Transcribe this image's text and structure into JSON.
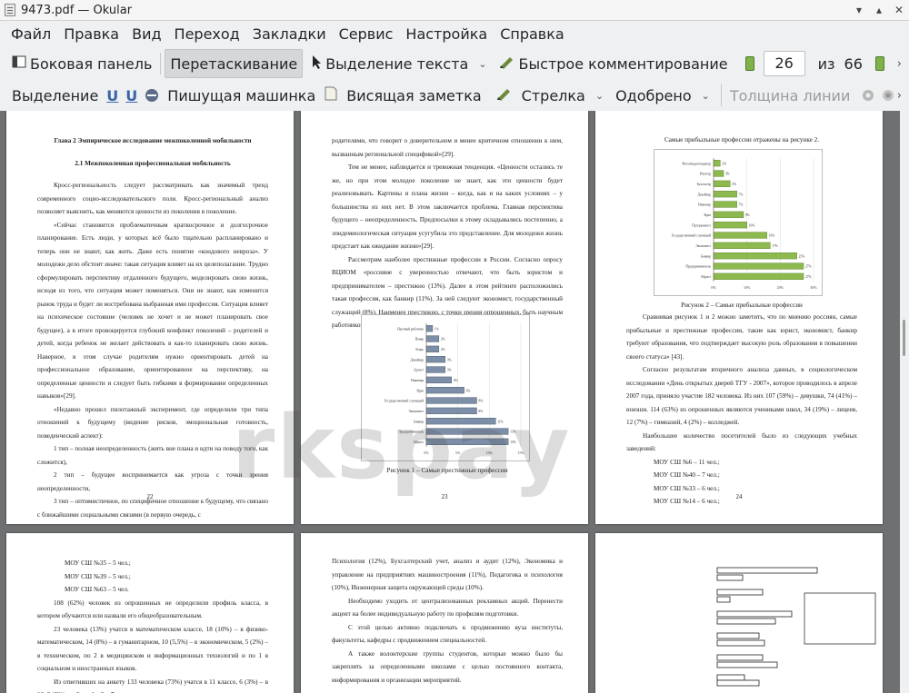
{
  "window": {
    "title": "9473.pdf — Okular"
  },
  "menu": [
    "Файл",
    "Правка",
    "Вид",
    "Переход",
    "Закладки",
    "Сервис",
    "Настройка",
    "Справка"
  ],
  "toolbar1": {
    "sidebar": "Боковая панель",
    "drag": "Перетаскивание",
    "text_select": "Выделение текста",
    "quick_comment": "Быстрое комментирование",
    "page_current": "26",
    "page_of": "из",
    "page_total": "66"
  },
  "toolbar2": {
    "highlight": "Выделение",
    "typewriter": "Пишущая машинка",
    "sticky_note": "Висящая заметка",
    "arrow": "Стрелка",
    "stamp": "Одобрено",
    "line_width": "Толщина линии"
  },
  "watermark": "rkspay",
  "pages": {
    "p22": {
      "heading1": "Глава 2 Эмпирическое исследование межпоколенной мобильности",
      "heading2": "2.1 Межпоколенная профессиональная мобильность",
      "paras": [
        "Кросс-региональность следует рассматривать как значимый тренд современного социо-исследовательского поля. Кросс-региональный анализ позволяет выяснить, как меняются ценности из поколения в поколение.",
        "«Сейчас становится проблематичным краткосрочное и долгосрочное планирование. Есть люди, у которых всё было тщательно распланировано и теперь они не знают, как жить. Даже есть понятие «кондового невроза». У молодежи дело обстоит иначе: такая ситуация влияет на их целеполагание. Трудно сформулировать перспективу отдаленного будущего, моделировать свою жизнь, исходя из того, что ситуация может поменяться. Они не знают, как изменится рынок труда и будет ли востребована выбранная ими профессия. Ситуация влияет на психическое состояние (человек не хочет и не может планировать свое будущее), а в итоге провоцируется глубокий конфликт поколений – родителей и детей, когда ребенок не желает действовать в как-то планировать свою жизнь. Наверное, в этом случае родителям нужно ориентировать детей на профессиональное образование, ориентированное на перспективу, на определенные ценности и следует быть гибкими в формировании определенных навыков»[29].",
        "«Недавно прошел пилотажный эксперимент, где определили три типа отношений к будущему (видение рисков, эмоциональная готовность, поведенческий аспект):",
        "1 тип – полная неопределенность (жить вне плана и идти на поводу того, как сложится),",
        "2 тип – будущее воспринимается как угроза с точки зрения неопределенности,",
        "3 тип – оптимистичное, по специфичное отношение к будущему, что связано с ближайшими социальными связями (в первую очередь, с"
      ],
      "number": "22"
    },
    "p23": {
      "paras": [
        "родителями, что говорит о доверительном и менее критичном отношении к ним, вызванным региональной спецификой»[29].",
        "Тем не менее, наблюдается и тревожная тенденция. «Ценности остались те же, но при этом молодое поколение не знает, как эти ценности будет реализовывать. Картины и плана жизни – когда, как и на каких условиях – у большинства из них нет. В этом заключается проблема. Главная перспектива будущего – неопределенность. Предпосылки к этому складывались постепенно, а эпидемиологическая ситуация усугубила это представление. Для молодежи жизнь предстает как ожидание жизни»[29].",
        "Рассмотрим наиболее престижные профессии в России. Согласно опросу ВЦИОМ «россияне с уверенностью отвечают, что быть юристом и предпринимателем – престижно (13%). Далее в этом рейтинге расположились такая профессия, как банкир (11%). За ней следуют экономист, государственный служащий (8%). Наименее престижно, с точки зрения опрошенных, быть научным работником и учителем» [23, 45]."
      ],
      "caption": "Рисунок 1 – Самые престижные профессии",
      "number": "23"
    },
    "p24": {
      "intro": "Самые прибыльные профессии отражены на рисунке 2.",
      "caption": "Рисунок 2 – Самые прибыльные профессии",
      "paras": [
        "Сравнивая рисунок 1 и 2 можно заметить, что по мнению россиян, самые прибыльные и престижные профессии, такие как юрист, экономист, банкир требуют образования, что подтверждает высокую роль образования в повышении своего статуса» [43].",
        "Согласно результатам вторичного анализа данных, в социологическом исследовании «День открытых дверей ТГУ - 2007», которое проводилось в апреле 2007 года, приняло участие 182 человека. Из них 107 (59%) – девушки, 74 (41%) – юноши. 114 (63%) из опрошенных являются учениками школ, 34 (19%) – лицеев, 12 (7%) – гимназий, 4 (2%) – колледжей.",
        "Наибольшее количество посетителей было из следующих учебных заведений:"
      ],
      "list": [
        "МОУ СШ №6 – 11 чел.;",
        "МОУ СШ №40 – 7 чел.;",
        "МОУ СШ №33 – 6 чел.;",
        "МОУ СШ №14 – 6 чел.;"
      ],
      "number": "24"
    },
    "p25": {
      "list": [
        "МОУ СШ №35 – 5 чел.;",
        "МОУ СШ №39 – 5 чел.;",
        "МОУ СШ №63 – 5 чел."
      ],
      "paras": [
        "108 (62%) человек из опрошенных не определили профиль класса, в котором обучаются или назвали его общеобразовательным.",
        "23 человека (13%) учатся в математическом классе, 18 (10%) – в физико-математическом, 14 (8%) – в гуманитарном, 10 (5,5%) – в экономическом, 5 (2%) – в техническом, по 2 в медицинском и информационных технологий и по 1 в социальном и иностранных языков.",
        "Из ответивших на анкету 133 человека (73%) учатся в 11 классе, 6 (3%) – в 10, 3 (2%) – в 9, по 1 в 8 и 7 классе."
      ]
    },
    "p26": {
      "paras": [
        "Психология (12%), Бухгалтерский учет, анализ и аудит (12%), Экономика и управление на предприятиях машиностроения (11%), Педагогика и психология (10%), Инженерная защита окружающей среды (10%).",
        "Необходимо уходить от централизованных рекламных акций. Перенести акцент на более индивидуальную работу по профилям подготовки.",
        "С этой целью активно подключать к продвижению вуза институты, факультеты, кафедры с продвижением специальностей.",
        "А также волонтерские группы студентов, которые можно было бы закреплять за определенными школами с целью постоянного контакта, информирования и организации мероприятий."
      ]
    }
  },
  "chart_data": [
    {
      "type": "bar",
      "title": "Рисунок 1 – Самые престижные профессии",
      "orientation": "horizontal",
      "categories": [
        "Юрист",
        "Предприниматель",
        "Банкир",
        "Экономист",
        "Государственный служащий",
        "Врач",
        "Инженер",
        "Артист",
        "Дизайнер",
        "Егерь",
        "Повар",
        "Научный работник"
      ],
      "values": [
        13,
        13,
        11,
        8,
        8,
        6,
        4,
        3,
        3,
        2,
        2,
        1
      ],
      "xlim": [
        0,
        15
      ],
      "ticks": [
        "0%",
        "5%",
        "10%",
        "15%"
      ]
    },
    {
      "type": "bar",
      "title": "Рисунок 2 – Самые прибыльные профессии",
      "orientation": "horizontal",
      "categories": [
        "Юрист",
        "Предприниматель",
        "Банкир",
        "Экономист",
        "Государственный служащий",
        "Программист",
        "Врач",
        "Инженер",
        "Дизайнер",
        "Бухгалтер",
        "Риэлтор",
        "Фото/видеооператор"
      ],
      "values": [
        27,
        27,
        25,
        17,
        16,
        10,
        9,
        7,
        7,
        5,
        3,
        2
      ],
      "xlim": [
        0,
        30
      ],
      "ticks": [
        "0%",
        "10%",
        "20%",
        "30%"
      ],
      "color": "#8db94f"
    }
  ]
}
